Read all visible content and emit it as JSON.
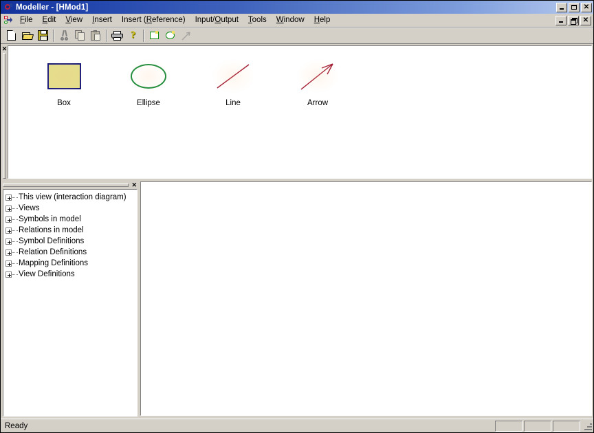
{
  "window": {
    "title": "Modeller - [HMod1]",
    "icon": "app-icon",
    "controls": {
      "minimize": "_",
      "maximize": "□",
      "close": "✕"
    }
  },
  "mdi": {
    "icon": "diagram-icon",
    "controls": {
      "minimize": "_",
      "restore": "❐",
      "close": "✕"
    }
  },
  "menubar": {
    "items": [
      {
        "label": "File",
        "accel": "F"
      },
      {
        "label": "Edit",
        "accel": "E"
      },
      {
        "label": "View",
        "accel": "V"
      },
      {
        "label": "Insert",
        "accel": "I"
      },
      {
        "label": "Insert (Reference)",
        "accel": "R"
      },
      {
        "label": "Input/Output",
        "accel": "O"
      },
      {
        "label": "Tools",
        "accel": "T"
      },
      {
        "label": "Window",
        "accel": "W"
      },
      {
        "label": "Help",
        "accel": "H"
      }
    ]
  },
  "toolbar": {
    "buttons": [
      {
        "name": "new",
        "icon": "new-document-icon",
        "enabled": true
      },
      {
        "name": "open",
        "icon": "open-folder-icon",
        "enabled": true
      },
      {
        "name": "save",
        "icon": "save-disk-icon",
        "enabled": true
      },
      {
        "name": "cut",
        "icon": "scissors-icon",
        "enabled": false
      },
      {
        "name": "copy",
        "icon": "copy-pages-icon",
        "enabled": false
      },
      {
        "name": "paste",
        "icon": "clipboard-icon",
        "enabled": false
      },
      {
        "name": "print",
        "icon": "printer-icon",
        "enabled": true
      },
      {
        "name": "help",
        "icon": "question-mark-icon",
        "enabled": true
      },
      {
        "name": "box",
        "icon": "box-tool-icon",
        "enabled": true
      },
      {
        "name": "ellipse",
        "icon": "ellipse-tool-icon",
        "enabled": true
      },
      {
        "name": "arrow",
        "icon": "arrow-tool-icon",
        "enabled": false
      }
    ]
  },
  "palette": {
    "close_label": "✕",
    "items": [
      {
        "label": "Box",
        "shape": "box-shape",
        "fill": "#e3dd8a",
        "stroke": "#1a1a78"
      },
      {
        "label": "Ellipse",
        "shape": "ellipse-shape",
        "fill": "none",
        "stroke": "#188a38"
      },
      {
        "label": "Line",
        "shape": "line-shape",
        "fill": "none",
        "stroke": "#a01830"
      },
      {
        "label": "Arrow",
        "shape": "arrow-shape",
        "fill": "none",
        "stroke": "#a01830"
      }
    ]
  },
  "tree": {
    "close_label": "✕",
    "nodes": [
      {
        "label": "This view (interaction diagram)",
        "expander": "plus"
      },
      {
        "label": "Views",
        "expander": "plus"
      },
      {
        "label": "Symbols in model",
        "expander": "plus"
      },
      {
        "label": "Relations in model",
        "expander": "plus"
      },
      {
        "label": "Symbol Definitions",
        "expander": "plus"
      },
      {
        "label": "Relation Definitions",
        "expander": "plus"
      },
      {
        "label": "Mapping Definitions",
        "expander": "plus"
      },
      {
        "label": "View Definitions",
        "expander": "plus"
      }
    ]
  },
  "statusbar": {
    "message": "Ready",
    "panes": [
      "",
      "",
      ""
    ]
  },
  "colors": {
    "face": "#d4d0c8",
    "title_start": "#12329a",
    "title_end": "#b8cbee",
    "box_fill": "#e3dd8a",
    "box_stroke": "#1a1a78",
    "ellipse_stroke": "#188a38",
    "line_stroke": "#a01830"
  }
}
